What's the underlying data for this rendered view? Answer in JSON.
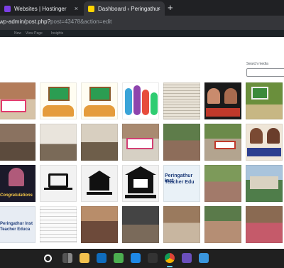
{
  "browser": {
    "tabs": [
      {
        "title": "Websites | Hostinger",
        "active": false,
        "favicon_color": "#7b3fe4"
      },
      {
        "title": "Dashboard ‹ Peringathur Teacher",
        "active": true,
        "favicon_color": "#ffd400"
      }
    ],
    "new_tab_glyph": "+",
    "close_glyph": "×",
    "url": {
      "visible_prefix": "wp-admin/post.php?",
      "visible_query": "post=43478&action=edit"
    }
  },
  "admin_bar": {
    "items": [
      "New",
      "View Page",
      "Insights"
    ]
  },
  "media": {
    "search_label": "Search media",
    "search_value": "",
    "poster_caption_1": "Peringathur Inst",
    "poster_caption_2": "Teacher Educa",
    "grid_caption_1": "Peringathur Inst",
    "grid_caption_2": "Teacher Edu",
    "congrats_text": "Congratulations"
  },
  "taskbar": {
    "icons": [
      "search-icon",
      "task-view-icon",
      "file-explorer-icon",
      "chrome-icon",
      "app-icon-1",
      "app-icon-2",
      "app-icon-3"
    ]
  }
}
